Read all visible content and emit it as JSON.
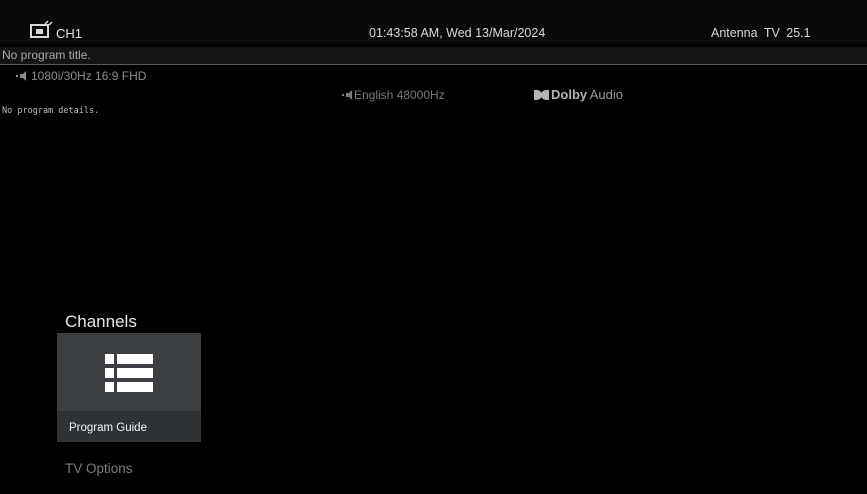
{
  "header": {
    "tv_icon": "tv-source-icon",
    "channel": "CH1",
    "clock": "01:43:58 AM, Wed 13/Mar/2024",
    "source": "Antenna  TV  25.1"
  },
  "program": {
    "title": "No program title.",
    "video_format": "1080i/30Hz 16:9 FHD",
    "audio_language": "English  48000Hz",
    "dolby_brand": "Dolby",
    "dolby_suffix": "Audio",
    "details": "No program details."
  },
  "menu": {
    "section_title": "Channels",
    "card": {
      "icon": "list-icon",
      "label": "Program Guide"
    },
    "items": [
      {
        "label": "TV Options"
      }
    ]
  },
  "colors": {
    "background": "#000000",
    "card_bg": "#2f3337",
    "text_primary": "#e8e8e8",
    "text_dim": "#7e7e7e"
  }
}
